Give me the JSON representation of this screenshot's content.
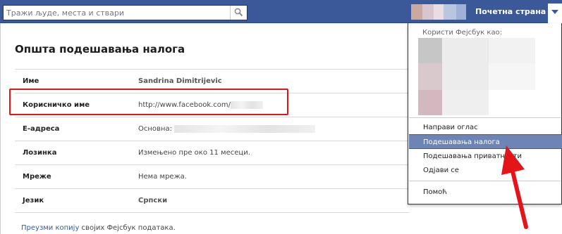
{
  "search": {
    "placeholder": "Тражи људе, места и ствари"
  },
  "header": {
    "home_label": "Почетна страна"
  },
  "settings": {
    "title": "Општа подешавања налога",
    "rows": [
      {
        "label": "Име",
        "value": "Sandrina Dimitrijevic"
      },
      {
        "label": "Корисничко име",
        "value": "http://www.facebook.com/"
      },
      {
        "label": "Е-адреса",
        "value": "Основна:"
      },
      {
        "label": "Лозинка",
        "value": "Измењено пре око 11 месеци."
      },
      {
        "label": "Мреже",
        "value": "Нема мрежа."
      },
      {
        "label": "Језик",
        "value": "Српски"
      }
    ]
  },
  "footer": {
    "link": "Преузми копију",
    "text": " својих Фејсбук података."
  },
  "menu": {
    "uses_as": "Користи Фејсбук као:",
    "items": [
      {
        "label": "Направи оглас"
      },
      {
        "label": "Подешавања налога"
      },
      {
        "label": "Подешавања приватности"
      },
      {
        "label": "Одјави се"
      },
      {
        "label": "Помоћ"
      }
    ]
  },
  "colors": {
    "header_blue": "#3b5998",
    "highlight_red": "#e3141a",
    "menu_active": "#6d84b4"
  },
  "icons": [
    "search-icon",
    "chevron-down-icon",
    "red-arrow-annotation"
  ]
}
